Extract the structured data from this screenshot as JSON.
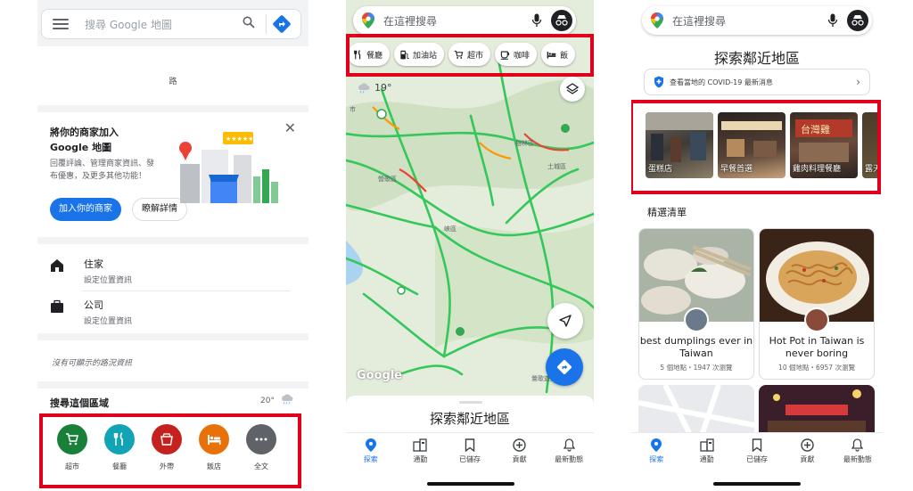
{
  "panel1": {
    "search_placeholder": "搜尋 Google 地圖",
    "road_label": "路",
    "promo": {
      "title": "將你的商家加入 Google 地圖",
      "description": "回覆評論、管理商家資訊、發布優惠，及更多其他功能！",
      "primary_button": "加入你的商家",
      "secondary_button": "瞭解詳情"
    },
    "places": [
      {
        "name": "住家",
        "sub": "設定位置資訊",
        "icon": "home-icon"
      },
      {
        "name": "公司",
        "sub": "設定位置資訊",
        "icon": "briefcase-icon"
      }
    ],
    "traffic_text": "沒有可顯示的路況資訊",
    "explore": {
      "title": "搜尋這個區域",
      "temperature": "20°"
    },
    "categories": [
      {
        "label": "超市",
        "color": "#188038",
        "icon": "cart-icon"
      },
      {
        "label": "餐廳",
        "color": "#12a4b4",
        "icon": "restaurant-icon"
      },
      {
        "label": "外帶",
        "color": "#c5221f",
        "icon": "takeout-icon"
      },
      {
        "label": "飯店",
        "color": "#e8710a",
        "icon": "hotel-icon"
      },
      {
        "label": "全文",
        "color": "#5f6368",
        "icon": "more-icon"
      }
    ],
    "highlight_color": "#e0001b"
  },
  "panel2": {
    "search_placeholder": "在這裡搜尋",
    "chips": [
      {
        "label": "餐廳",
        "icon": "restaurant-icon"
      },
      {
        "label": "加油站",
        "icon": "gas-station-icon"
      },
      {
        "label": "超市",
        "icon": "cart-icon"
      },
      {
        "label": "咖啡",
        "icon": "coffee-icon"
      },
      {
        "label": "飯",
        "icon": "hotel-icon"
      }
    ],
    "temperature": "19°",
    "map_labels": [
      "市",
      "樹林區",
      "土城區",
      "營歌區",
      "峽區",
      "鶯歌遊樂園",
      "土城區"
    ],
    "google_logo": "Google",
    "sheet_title": "探索鄰近地區",
    "tabs": [
      {
        "label": "探索",
        "icon": "explore-pin-icon",
        "active": true
      },
      {
        "label": "通勤",
        "icon": "commute-icon",
        "active": false
      },
      {
        "label": "已儲存",
        "icon": "bookmark-icon",
        "active": false
      },
      {
        "label": "貢獻",
        "icon": "add-circle-icon",
        "active": false
      },
      {
        "label": "最新動態",
        "icon": "bell-icon",
        "active": false
      }
    ]
  },
  "panel3": {
    "search_placeholder": "在這裡搜尋",
    "title": "探索鄰近地區",
    "covid_text": "查看當地的 COVID-19 最新消息",
    "thumbnails": [
      {
        "label": "蛋糕店"
      },
      {
        "label": "早餐首選"
      },
      {
        "label": "雞肉料理餐廳"
      },
      {
        "label": "露天"
      }
    ],
    "section_title": "精選清單",
    "cards": [
      {
        "title": "best dumplings ever in Taiwan",
        "sub": "5 個地點・1947 次瀏覽"
      },
      {
        "title": "Hot Pot in Taiwan is never boring",
        "sub": "10 個地點・6957 次瀏覽"
      }
    ],
    "tabs": [
      {
        "label": "探索",
        "icon": "explore-pin-icon",
        "active": true
      },
      {
        "label": "通勤",
        "icon": "commute-icon",
        "active": false
      },
      {
        "label": "已儲存",
        "icon": "bookmark-icon",
        "active": false
      },
      {
        "label": "貢獻",
        "icon": "add-circle-icon",
        "active": false
      },
      {
        "label": "最新動態",
        "icon": "bell-icon",
        "active": false
      }
    ]
  }
}
